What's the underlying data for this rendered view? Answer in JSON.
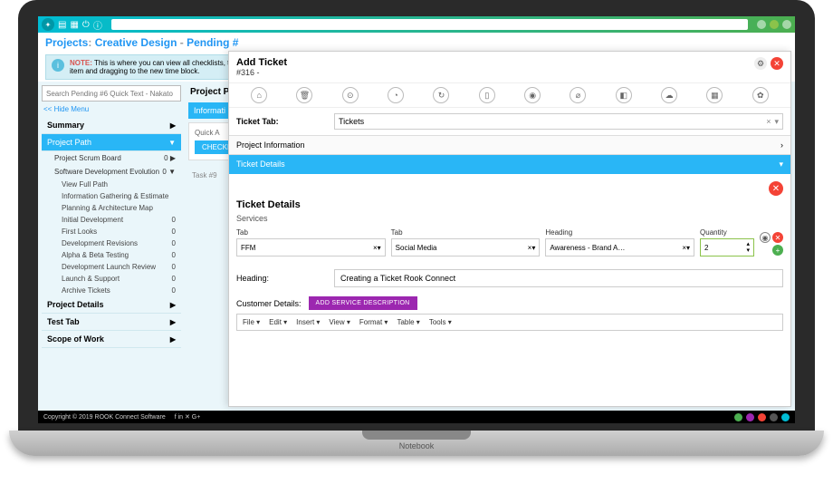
{
  "breadcrumb": {
    "a": "Projects",
    "b": "Creative Design",
    "c": "Pending #"
  },
  "note": {
    "label": "NOTE:",
    "text": "This is where you can view all checklists, ticke",
    "text2": "item and dragging to the new time block."
  },
  "sidebar": {
    "search_ph": "Search Pending #6 Quick Text - Nakato",
    "hide": "<< Hide Menu",
    "summary": "Summary",
    "path": "Project Path",
    "items": [
      {
        "label": "Project Scrum Board",
        "badge": "0 ▶"
      },
      {
        "label": "Software Development Evolution",
        "badge": "0 ▼"
      }
    ],
    "subs": [
      {
        "label": "View Full Path",
        "badge": ""
      },
      {
        "label": "Information Gathering & Estimate",
        "badge": ""
      },
      {
        "label": "Planning & Architecture Map",
        "badge": ""
      },
      {
        "label": "Initial Development",
        "badge": "0"
      },
      {
        "label": "First Looks",
        "badge": "0"
      },
      {
        "label": "Development Revisions",
        "badge": "0"
      },
      {
        "label": "Alpha & Beta Testing",
        "badge": "0"
      },
      {
        "label": "Development Launch Review",
        "badge": "0"
      },
      {
        "label": "Launch & Support",
        "badge": "0"
      },
      {
        "label": "Archive Tickets",
        "badge": "0"
      }
    ],
    "details": "Project Details",
    "testtab": "Test Tab",
    "scope": "Scope of Work"
  },
  "main": {
    "hdr": "Project P",
    "info": "Informati",
    "qa": "Quick A",
    "chk": "CHECKL",
    "task": "Task #9"
  },
  "modal": {
    "title": "Add Ticket",
    "sub": "#316 -",
    "tab_label": "Ticket Tab:",
    "tab_value": "Tickets",
    "sec1": "Project Information",
    "sec2": "Ticket Details",
    "body_title": "Ticket Details",
    "body_sub": "Services",
    "c1": "Tab",
    "c1v": "FFM",
    "c2": "Tab",
    "c2v": "Social Media",
    "c3": "Heading",
    "c3v": "Awareness - Brand A…",
    "c4": "Quantity",
    "c4v": "2",
    "heading_label": "Heading:",
    "heading_value": "Creating a Ticket Rook Connect",
    "cust": "Customer Details:",
    "add_desc": "ADD SERVICE DESCRIPTION",
    "ed": [
      "File ▾",
      "Edit ▾",
      "Insert ▾",
      "View ▾",
      "Format ▾",
      "Table ▾",
      "Tools ▾"
    ]
  },
  "footer": {
    "copy": "Copyright © 2019 ROOK Connect Software",
    "icons": "f  in  ✕  G+"
  },
  "base": "Notebook"
}
